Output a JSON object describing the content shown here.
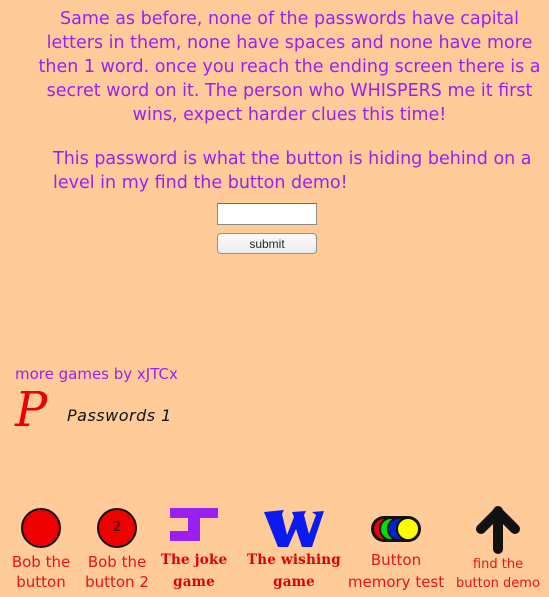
{
  "intro": {
    "text": "Same as before, none of the passwords have capital letters in them, none have spaces and none have more then 1 word. once you reach the ending screen there is a secret word on it. The person who WHISPERS me it first wins, expect harder clues this time!"
  },
  "hint": {
    "text": "This password is what the button is hiding behind on a level in my find the button demo!"
  },
  "form": {
    "password_value": "",
    "password_placeholder": "",
    "submit_label": "submit"
  },
  "footer": {
    "more_games_label": "more games by xJTCx",
    "logo_letter": "P",
    "logo_title": "Passwords 1"
  },
  "games": [
    {
      "label_line1": "Bob the",
      "label_line2": "button",
      "icon": "red-circle-button-icon",
      "icon_text": ""
    },
    {
      "label_line1": "Bob the",
      "label_line2": "button 2",
      "icon": "red-circle-button-2-icon",
      "icon_text": "2"
    },
    {
      "label_line1": "The joke",
      "label_line2": "game",
      "icon": "purple-j-letter-icon"
    },
    {
      "label_line1": "The wishing",
      "label_line2": "game",
      "icon": "blue-w-letter-icon"
    },
    {
      "label_line1": "Button",
      "label_line2": "memory test",
      "icon": "colored-buttons-icon"
    },
    {
      "label_line1": "find the",
      "label_line2": "button demo",
      "icon": "up-arrow-icon"
    }
  ],
  "colors": {
    "background": "#ffcc99",
    "purple_text": "#9b1ff0",
    "red": "#ee0000",
    "joke_purple": "#9a1ff0",
    "wish_blue": "#0a1af0",
    "memory_red": "#ee0000",
    "memory_green": "#00dd00",
    "memory_blue": "#0022dd",
    "memory_yellow": "#ffff00"
  }
}
